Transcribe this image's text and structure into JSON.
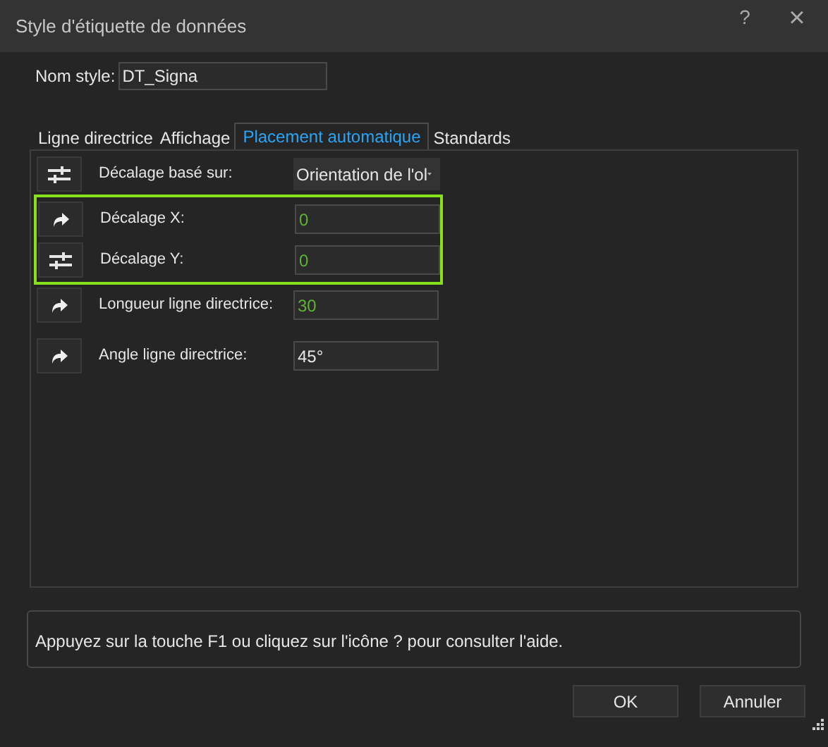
{
  "window": {
    "title": "Style d'étiquette de données",
    "help_button": "?",
    "close_button": "×"
  },
  "name_field": {
    "label": "Nom style:",
    "value": "DT_Signa"
  },
  "tabs": [
    {
      "label": "Ligne directrice",
      "selected": false
    },
    {
      "label": "Affichage",
      "selected": false
    },
    {
      "label": "Placement automatique",
      "selected": true
    },
    {
      "label": "Standards",
      "selected": false
    }
  ],
  "rows": [
    {
      "label": "Décalage basé sur:",
      "kind": "dropdown",
      "value": "Orientation de l'ol",
      "highlighted": false
    },
    {
      "label": "Décalage X:",
      "kind": "field",
      "value": "0",
      "color": "#5fb336",
      "highlighted": true
    },
    {
      "label": "Décalage Y:",
      "kind": "field",
      "value": "0",
      "color": "#5fb336",
      "highlighted": true
    },
    {
      "label": "Longueur ligne directrice:",
      "kind": "field",
      "value": "30",
      "color": "#5fb336",
      "highlighted": false
    },
    {
      "label": "Angle ligne directrice:",
      "kind": "field",
      "value": "45°",
      "color": "#e6e6e6",
      "highlighted": false
    }
  ],
  "help_text": "Appuyez sur la touche F1 ou cliquez sur l'icône ? pour consulter l'aide.",
  "buttons": [
    "OK",
    "Annuler"
  ]
}
